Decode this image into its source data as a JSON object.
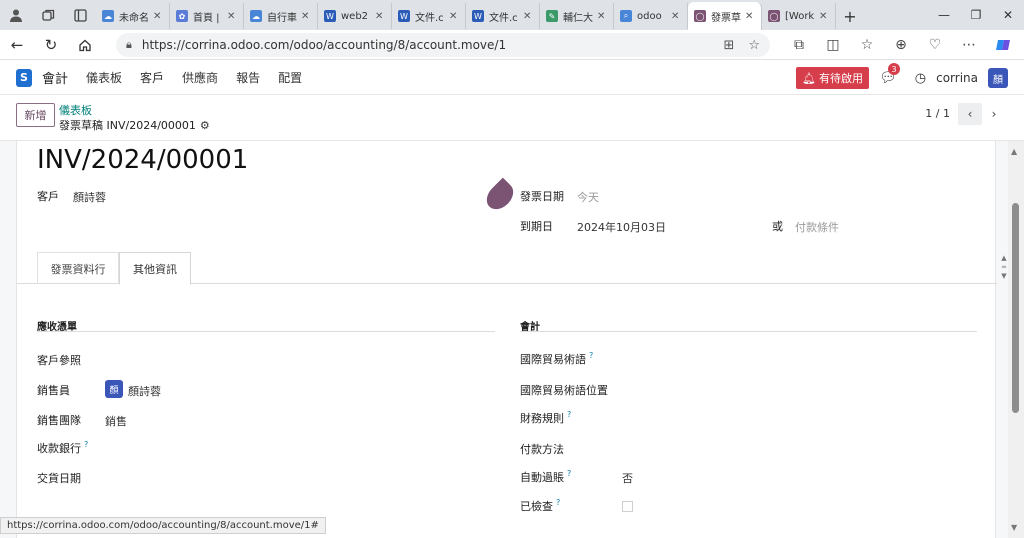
{
  "browser": {
    "tabs": [
      {
        "label": "未命名",
        "icon": "cloud-icon",
        "color": "#4a86d8"
      },
      {
        "label": "首頁 |",
        "icon": "gear-icon",
        "color": "#5a7bd6"
      },
      {
        "label": "自行車",
        "icon": "cloud-icon",
        "color": "#4a86d8"
      },
      {
        "label": "web2",
        "icon": "word-icon",
        "color": "#2b5db8"
      },
      {
        "label": "文件.c",
        "icon": "word-icon",
        "color": "#2b5db8"
      },
      {
        "label": "文件.c",
        "icon": "word-icon",
        "color": "#2b5db8"
      },
      {
        "label": "輔仁大",
        "icon": "pen-icon",
        "color": "#3a9a6a"
      },
      {
        "label": "odoo",
        "icon": "search-icon",
        "color": "#4a86d8"
      },
      {
        "label": "發票草",
        "icon": "odoo-icon",
        "color": "#7b5473",
        "active": true
      },
      {
        "label": "[Work",
        "icon": "odoo-icon",
        "color": "#7b5473"
      }
    ],
    "url": "https://corrina.odoo.com/odoo/accounting/8/account.move/1",
    "status_url": "https://corrina.odoo.com/odoo/accounting/8/account.move/1#"
  },
  "odoo_nav": {
    "app_name": "會計",
    "menu": [
      "儀表板",
      "客戶",
      "供應商",
      "報告",
      "配置"
    ],
    "pending_label": "有待啟用",
    "chat_count": "3",
    "user_name": "corrina",
    "user_initial": "顏"
  },
  "control_panel": {
    "new_label": "新增",
    "breadcrumb_parent": "儀表板",
    "breadcrumb_current": "發票草稿 INV/2024/00001",
    "pager": "1 / 1"
  },
  "form": {
    "title": "INV/2024/00001",
    "customer_label": "客戶",
    "customer_value": "顏詩蓉",
    "invoice_date_label": "發票日期",
    "invoice_date_placeholder": "今天",
    "due_date_label": "到期日",
    "due_date_value": "2024年10月03日",
    "or_label": "或",
    "payment_terms_placeholder": "付款條件",
    "tabs": {
      "lines": "發票資料行",
      "other": "其他資訊"
    },
    "receivable_section": "應收憑單",
    "accounting_section": "會計",
    "left_fields": {
      "customer_ref": "客戶參照",
      "salesperson": "銷售員",
      "salesperson_value": "顏詩蓉",
      "salesperson_initial": "顏",
      "sales_team": "銷售團隊",
      "sales_team_value": "銷售",
      "bank": "收款銀行",
      "delivery_date": "交貨日期"
    },
    "right_fields": {
      "incoterm": "國際貿易術語",
      "incoterm_location": "國際貿易術語位置",
      "fiscal_position": "財務規則",
      "payment_method": "付款方法",
      "auto_post": "自動過賬",
      "auto_post_value": "否",
      "checked": "已檢查"
    }
  }
}
